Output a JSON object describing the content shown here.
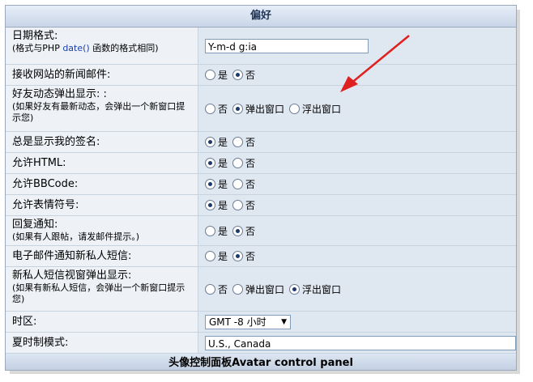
{
  "panel": {
    "title": "偏好",
    "footer": "头像控制面板Avatar control panel"
  },
  "rows": {
    "date_format": {
      "label": "日期格式:",
      "sub_prefix": "(格式与PHP ",
      "sub_link": "date()",
      "sub_suffix": " 函数的格式相同)",
      "value": "Y-m-d g:ia"
    },
    "newsletter": {
      "label": "接收网站的新闻邮件:",
      "opt_yes": "是",
      "opt_no": "否",
      "selected": "否"
    },
    "friend_popup": {
      "label": "好友动态弹出显示: :",
      "sub": "(如果好友有最新动态，会弹出一个新窗口提示您)",
      "opt_no": "否",
      "opt_popup": "弹出窗口",
      "opt_float": "浮出窗口",
      "selected": "弹出窗口"
    },
    "show_sig": {
      "label": "总是显示我的签名:",
      "opt_yes": "是",
      "opt_no": "否",
      "selected": "是"
    },
    "allow_html": {
      "label": "允许HTML:",
      "opt_yes": "是",
      "opt_no": "否",
      "selected": "是"
    },
    "allow_bbcode": {
      "label": "允许BBCode:",
      "opt_yes": "是",
      "opt_no": "否",
      "selected": "是"
    },
    "allow_smilies": {
      "label": "允许表情符号:",
      "opt_yes": "是",
      "opt_no": "否",
      "selected": "是"
    },
    "reply_notify": {
      "label": "回复通知:",
      "sub": "(如果有人跟帖，请发邮件提示。)",
      "opt_yes": "是",
      "opt_no": "否",
      "selected": "否"
    },
    "pm_email": {
      "label": "电子邮件通知新私人短信:",
      "opt_yes": "是",
      "opt_no": "否",
      "selected": "否"
    },
    "pm_popup": {
      "label": "新私人短信视窗弹出显示:",
      "sub": "(如果有新私人短信，会弹出一个新窗口提示您)",
      "opt_no": "否",
      "opt_popup": "弹出窗口",
      "opt_float": "浮出窗口",
      "selected": "浮出窗口"
    },
    "timezone": {
      "label": "时区:",
      "value": "GMT -8 小时"
    },
    "dst": {
      "label": "夏时制模式:",
      "value": "U.S., Canada"
    }
  },
  "colors": {
    "arrow": "#e02020",
    "header_text": "#1e3354",
    "link": "#1a3fa8"
  }
}
